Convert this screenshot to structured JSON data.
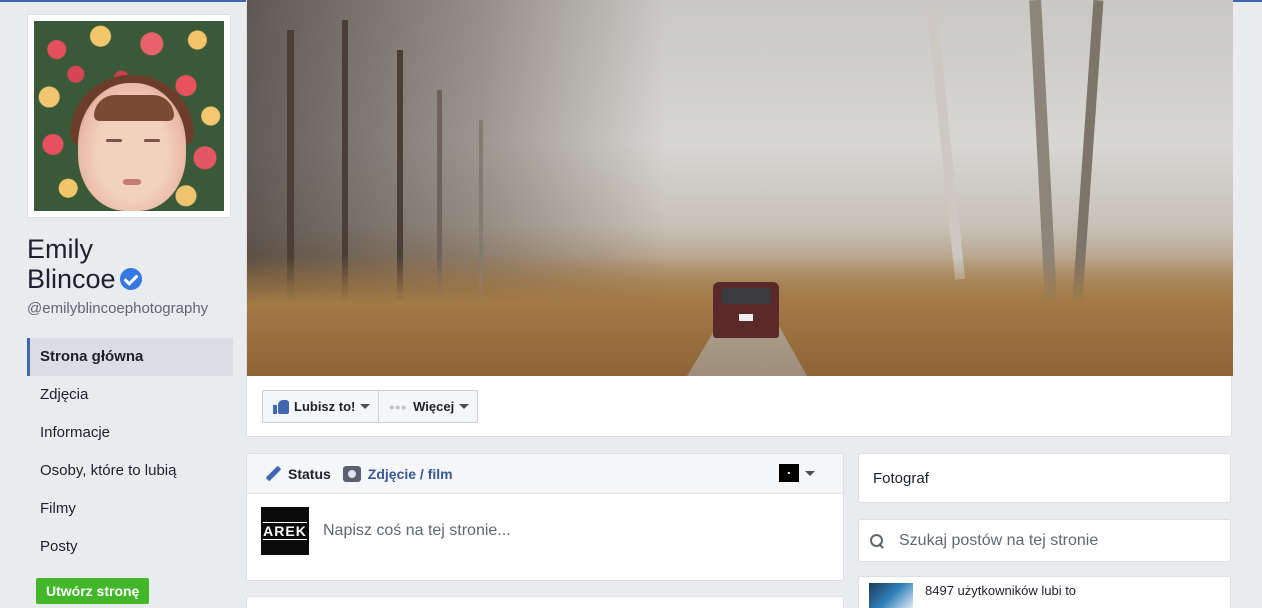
{
  "profile": {
    "name_line1": "Emily",
    "name_line2": "Blincoe",
    "handle": "@emilyblincoephotography",
    "verified": true
  },
  "nav": {
    "items": [
      {
        "label": "Strona główna",
        "active": true
      },
      {
        "label": "Zdjęcia"
      },
      {
        "label": "Informacje"
      },
      {
        "label": "Osoby, które to lubią"
      },
      {
        "label": "Filmy"
      },
      {
        "label": "Posty"
      }
    ],
    "create_page": "Utwórz stronę"
  },
  "cover_actions": {
    "like": "Lubisz to!",
    "more": "Więcej"
  },
  "composer": {
    "tab_status": "Status",
    "tab_photo": "Zdjęcie / film",
    "placeholder": "Napisz coś na tej stronie...",
    "page_logo_text": "AREK"
  },
  "sidebar": {
    "category": "Fotograf",
    "search_placeholder": "Szukaj postów na tej stronie",
    "likes_text": "8497 użytkowników lubi to"
  },
  "colors": {
    "accent": "#4267b2",
    "create_button": "#42b72a",
    "verified": "#3578e5"
  }
}
